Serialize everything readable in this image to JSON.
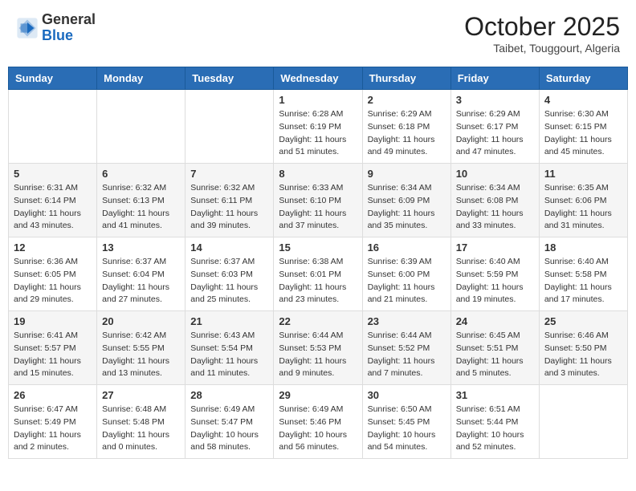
{
  "header": {
    "logo_general": "General",
    "logo_blue": "Blue",
    "month_title": "October 2025",
    "location": "Taibet, Touggourt, Algeria"
  },
  "days_of_week": [
    "Sunday",
    "Monday",
    "Tuesday",
    "Wednesday",
    "Thursday",
    "Friday",
    "Saturday"
  ],
  "weeks": [
    [
      null,
      null,
      null,
      {
        "day": 1,
        "sunrise": "Sunrise: 6:28 AM",
        "sunset": "Sunset: 6:19 PM",
        "daylight": "Daylight: 11 hours and 51 minutes."
      },
      {
        "day": 2,
        "sunrise": "Sunrise: 6:29 AM",
        "sunset": "Sunset: 6:18 PM",
        "daylight": "Daylight: 11 hours and 49 minutes."
      },
      {
        "day": 3,
        "sunrise": "Sunrise: 6:29 AM",
        "sunset": "Sunset: 6:17 PM",
        "daylight": "Daylight: 11 hours and 47 minutes."
      },
      {
        "day": 4,
        "sunrise": "Sunrise: 6:30 AM",
        "sunset": "Sunset: 6:15 PM",
        "daylight": "Daylight: 11 hours and 45 minutes."
      }
    ],
    [
      {
        "day": 5,
        "sunrise": "Sunrise: 6:31 AM",
        "sunset": "Sunset: 6:14 PM",
        "daylight": "Daylight: 11 hours and 43 minutes."
      },
      {
        "day": 6,
        "sunrise": "Sunrise: 6:32 AM",
        "sunset": "Sunset: 6:13 PM",
        "daylight": "Daylight: 11 hours and 41 minutes."
      },
      {
        "day": 7,
        "sunrise": "Sunrise: 6:32 AM",
        "sunset": "Sunset: 6:11 PM",
        "daylight": "Daylight: 11 hours and 39 minutes."
      },
      {
        "day": 8,
        "sunrise": "Sunrise: 6:33 AM",
        "sunset": "Sunset: 6:10 PM",
        "daylight": "Daylight: 11 hours and 37 minutes."
      },
      {
        "day": 9,
        "sunrise": "Sunrise: 6:34 AM",
        "sunset": "Sunset: 6:09 PM",
        "daylight": "Daylight: 11 hours and 35 minutes."
      },
      {
        "day": 10,
        "sunrise": "Sunrise: 6:34 AM",
        "sunset": "Sunset: 6:08 PM",
        "daylight": "Daylight: 11 hours and 33 minutes."
      },
      {
        "day": 11,
        "sunrise": "Sunrise: 6:35 AM",
        "sunset": "Sunset: 6:06 PM",
        "daylight": "Daylight: 11 hours and 31 minutes."
      }
    ],
    [
      {
        "day": 12,
        "sunrise": "Sunrise: 6:36 AM",
        "sunset": "Sunset: 6:05 PM",
        "daylight": "Daylight: 11 hours and 29 minutes."
      },
      {
        "day": 13,
        "sunrise": "Sunrise: 6:37 AM",
        "sunset": "Sunset: 6:04 PM",
        "daylight": "Daylight: 11 hours and 27 minutes."
      },
      {
        "day": 14,
        "sunrise": "Sunrise: 6:37 AM",
        "sunset": "Sunset: 6:03 PM",
        "daylight": "Daylight: 11 hours and 25 minutes."
      },
      {
        "day": 15,
        "sunrise": "Sunrise: 6:38 AM",
        "sunset": "Sunset: 6:01 PM",
        "daylight": "Daylight: 11 hours and 23 minutes."
      },
      {
        "day": 16,
        "sunrise": "Sunrise: 6:39 AM",
        "sunset": "Sunset: 6:00 PM",
        "daylight": "Daylight: 11 hours and 21 minutes."
      },
      {
        "day": 17,
        "sunrise": "Sunrise: 6:40 AM",
        "sunset": "Sunset: 5:59 PM",
        "daylight": "Daylight: 11 hours and 19 minutes."
      },
      {
        "day": 18,
        "sunrise": "Sunrise: 6:40 AM",
        "sunset": "Sunset: 5:58 PM",
        "daylight": "Daylight: 11 hours and 17 minutes."
      }
    ],
    [
      {
        "day": 19,
        "sunrise": "Sunrise: 6:41 AM",
        "sunset": "Sunset: 5:57 PM",
        "daylight": "Daylight: 11 hours and 15 minutes."
      },
      {
        "day": 20,
        "sunrise": "Sunrise: 6:42 AM",
        "sunset": "Sunset: 5:55 PM",
        "daylight": "Daylight: 11 hours and 13 minutes."
      },
      {
        "day": 21,
        "sunrise": "Sunrise: 6:43 AM",
        "sunset": "Sunset: 5:54 PM",
        "daylight": "Daylight: 11 hours and 11 minutes."
      },
      {
        "day": 22,
        "sunrise": "Sunrise: 6:44 AM",
        "sunset": "Sunset: 5:53 PM",
        "daylight": "Daylight: 11 hours and 9 minutes."
      },
      {
        "day": 23,
        "sunrise": "Sunrise: 6:44 AM",
        "sunset": "Sunset: 5:52 PM",
        "daylight": "Daylight: 11 hours and 7 minutes."
      },
      {
        "day": 24,
        "sunrise": "Sunrise: 6:45 AM",
        "sunset": "Sunset: 5:51 PM",
        "daylight": "Daylight: 11 hours and 5 minutes."
      },
      {
        "day": 25,
        "sunrise": "Sunrise: 6:46 AM",
        "sunset": "Sunset: 5:50 PM",
        "daylight": "Daylight: 11 hours and 3 minutes."
      }
    ],
    [
      {
        "day": 26,
        "sunrise": "Sunrise: 6:47 AM",
        "sunset": "Sunset: 5:49 PM",
        "daylight": "Daylight: 11 hours and 2 minutes."
      },
      {
        "day": 27,
        "sunrise": "Sunrise: 6:48 AM",
        "sunset": "Sunset: 5:48 PM",
        "daylight": "Daylight: 11 hours and 0 minutes."
      },
      {
        "day": 28,
        "sunrise": "Sunrise: 6:49 AM",
        "sunset": "Sunset: 5:47 PM",
        "daylight": "Daylight: 10 hours and 58 minutes."
      },
      {
        "day": 29,
        "sunrise": "Sunrise: 6:49 AM",
        "sunset": "Sunset: 5:46 PM",
        "daylight": "Daylight: 10 hours and 56 minutes."
      },
      {
        "day": 30,
        "sunrise": "Sunrise: 6:50 AM",
        "sunset": "Sunset: 5:45 PM",
        "daylight": "Daylight: 10 hours and 54 minutes."
      },
      {
        "day": 31,
        "sunrise": "Sunrise: 6:51 AM",
        "sunset": "Sunset: 5:44 PM",
        "daylight": "Daylight: 10 hours and 52 minutes."
      },
      null
    ]
  ]
}
